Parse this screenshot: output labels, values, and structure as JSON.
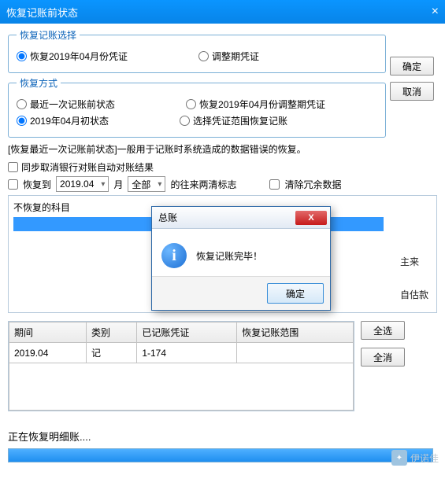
{
  "title": "恢复记账前状态",
  "close_glyph": "×",
  "group1": {
    "legend": "恢复记账选择",
    "opt1": "恢复2019年04月份凭证",
    "opt2": "调整期凭证"
  },
  "group2": {
    "legend": "恢复方式",
    "opt1": "最近一次记账前状态",
    "opt2": "恢复2019年04月份调整期凭证",
    "opt3": "2019年04月初状态",
    "opt4": "选择凭证范围恢复记账"
  },
  "buttons": {
    "ok": "确定",
    "cancel": "取消",
    "select_all": "全选",
    "deselect_all": "全消"
  },
  "desc": "[恢复最近一次记账前状态]一般用于记账时系统造成的数据错误的恢复。",
  "chk_sync": "同步取消银行对账自动对账结果",
  "restore_to_label": "恢复到",
  "restore_to_value": "2019.04",
  "month_label": "月",
  "scope_value": "全部",
  "flag_label": "的往来两清标志",
  "chk_clear": "清除冗余数据",
  "subjects_header": "不恢复的科目",
  "peek1": "主来",
  "peek2": "自估款",
  "table": {
    "headers": [
      "期间",
      "类别",
      "已记账凭证",
      "恢复记账范围"
    ],
    "row": {
      "period": "2019.04",
      "type": "记",
      "vouchers": "1-174",
      "range": ""
    }
  },
  "status": "正在恢复明细账....",
  "modal": {
    "title": "总账",
    "message": "恢复记账完毕！",
    "ok": "确定",
    "close": "X"
  },
  "watermark": "伊诺佳"
}
